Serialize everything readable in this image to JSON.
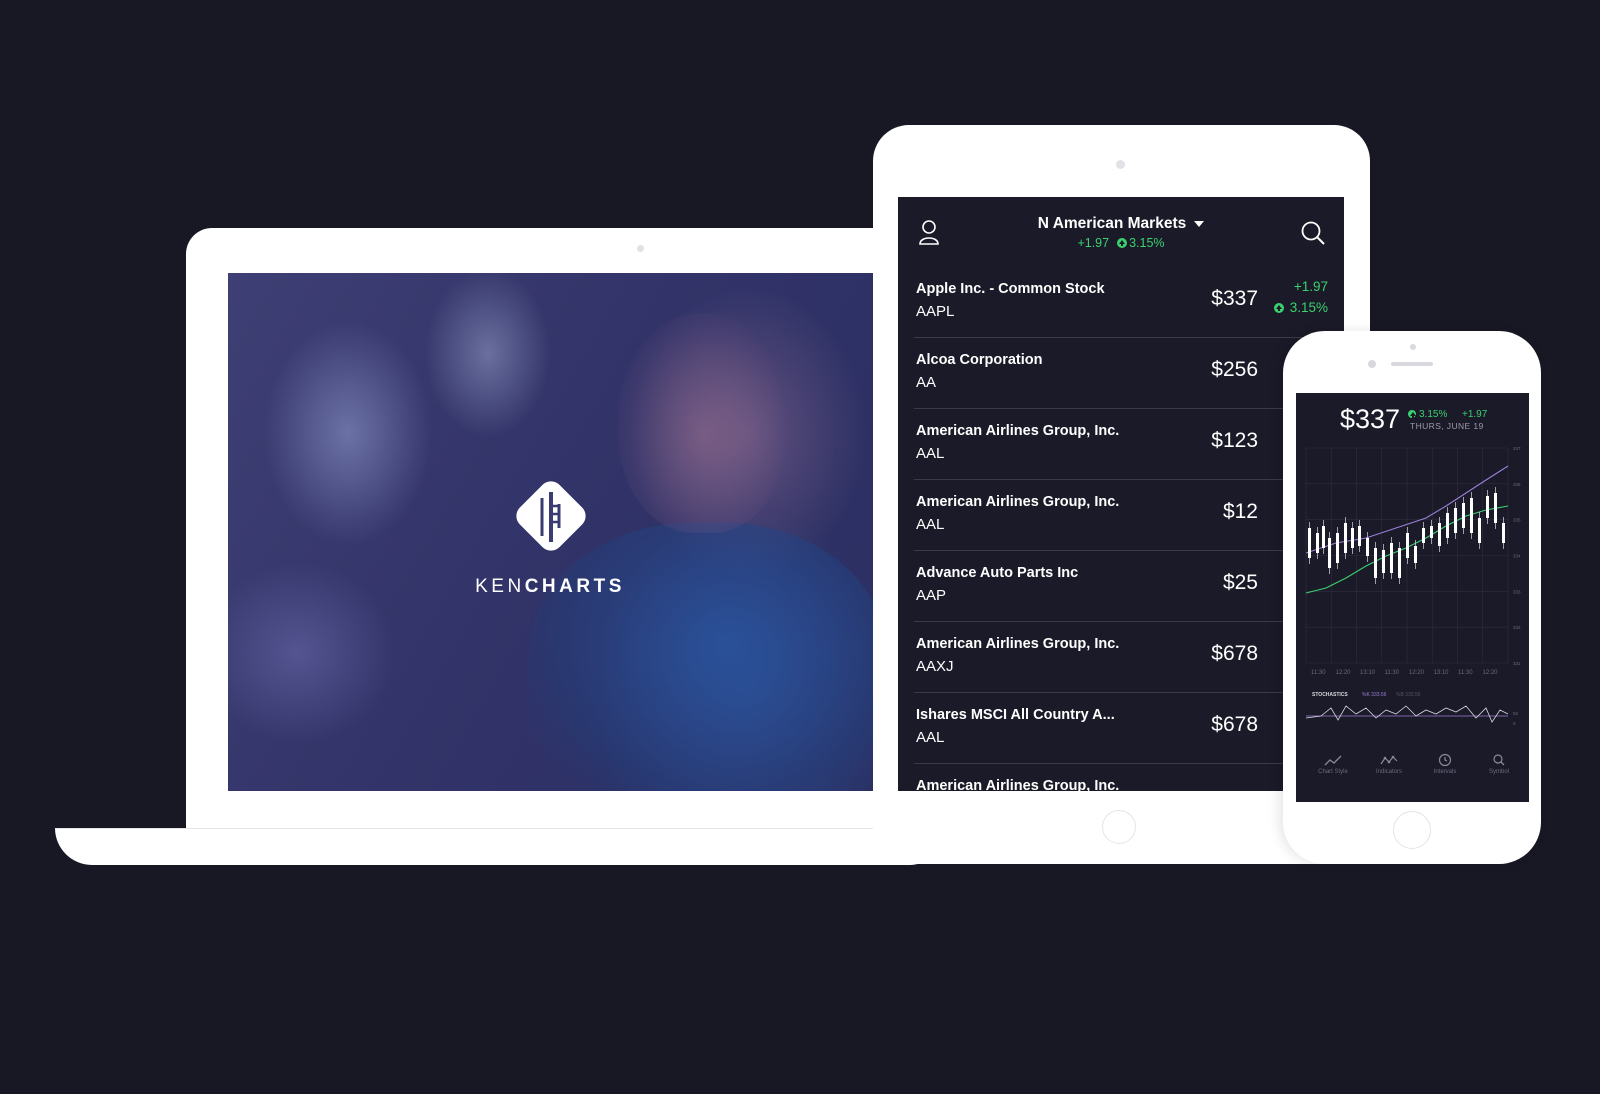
{
  "laptop": {
    "brand": {
      "part1": "KEN",
      "part2": "CHARTS"
    }
  },
  "tablet": {
    "header": {
      "title": "N American Markets",
      "change": "+1.97",
      "percent": "3.15%"
    },
    "stocks": [
      {
        "name": "Apple Inc. - Common Stock",
        "symbol": "AAPL",
        "price": "$337",
        "change": "+1.97",
        "percent": "3.15%",
        "direction": "up"
      },
      {
        "name": "Alcoa Corporation",
        "symbol": "AA",
        "price": "$256",
        "direction": "down"
      },
      {
        "name": "American Airlines Group, Inc.",
        "symbol": "AAL",
        "price": "$123",
        "direction": "up"
      },
      {
        "name": "American Airlines Group, Inc.",
        "symbol": "AAL",
        "price": "$12",
        "direction": "down"
      },
      {
        "name": "Advance Auto Parts Inc",
        "symbol": "AAP",
        "price": "$25",
        "direction": "up"
      },
      {
        "name": "American Airlines Group, Inc.",
        "symbol": "AAXJ",
        "price": "$678",
        "direction": "down"
      },
      {
        "name": "Ishares MSCI All Country A...",
        "symbol": "AAL",
        "price": "$678",
        "direction": "up"
      },
      {
        "name": "American Airlines Group, Inc.",
        "symbol": "",
        "price": "",
        "direction": ""
      }
    ]
  },
  "phone": {
    "price": "$337",
    "percent": "3.15%",
    "change": "+1.97",
    "date": "THURS, JUNE 19",
    "chart": {
      "y_ticks": [
        "337",
        "336",
        "335",
        "334",
        "333",
        "332",
        "331"
      ],
      "x_ticks": [
        "11:30",
        "12:20",
        "13:10",
        "11:30",
        "12:20",
        "13:10",
        "11:30",
        "12:20"
      ],
      "stochastics_label": "STOCHASTICS",
      "k_label": "%K 333.56",
      "d_label": "%B 333.56",
      "stoch_ticks": [
        "50",
        "0"
      ]
    },
    "tabs": [
      {
        "label": "Chart Style",
        "icon": "trend-icon"
      },
      {
        "label": "Indicators",
        "icon": "indicators-icon"
      },
      {
        "label": "Intervals",
        "icon": "clock-icon"
      },
      {
        "label": "Symbol",
        "icon": "search-icon"
      }
    ]
  },
  "colors": {
    "background": "#181825",
    "screen": "#1a1a28",
    "up": "#3bd16f",
    "down": "#e0454b",
    "purple_line": "#9b7fd6",
    "green_line": "#3bd16f"
  }
}
